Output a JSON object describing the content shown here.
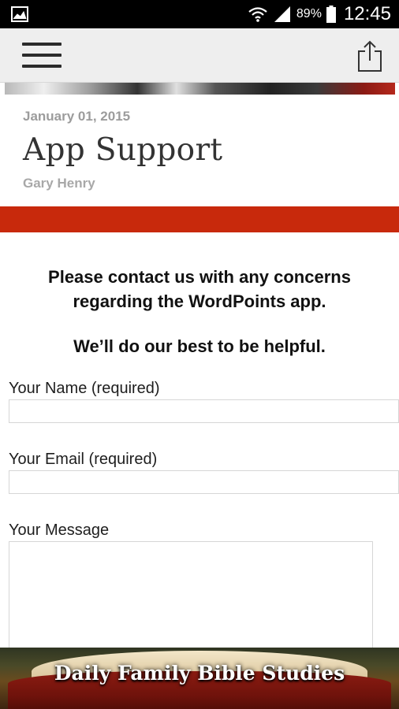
{
  "status_bar": {
    "battery_percent": "89%",
    "time": "12:45",
    "icons": [
      "gallery-icon",
      "wifi-icon",
      "signal-icon",
      "battery-icon"
    ]
  },
  "app_bar": {
    "icons": [
      "hamburger-menu-icon",
      "share-icon"
    ]
  },
  "post": {
    "date": "January 01, 2015",
    "title": "App Support",
    "author": "Gary Henry"
  },
  "content": {
    "intro_line": "Please contact us with any concerns regarding the WordPoints app.",
    "helpful_line": "We’ll do our best to be helpful."
  },
  "form": {
    "name_label": "Your Name (required)",
    "name_value": "",
    "email_label": "Your Email (required)",
    "email_value": "",
    "message_label": "Your Message",
    "message_value": ""
  },
  "banner": {
    "title": "Daily Family Bible Studies"
  },
  "colors": {
    "accent_red": "#c8290c",
    "meta_gray": "#9c9c9c",
    "appbar_bg": "#eeeeee"
  }
}
